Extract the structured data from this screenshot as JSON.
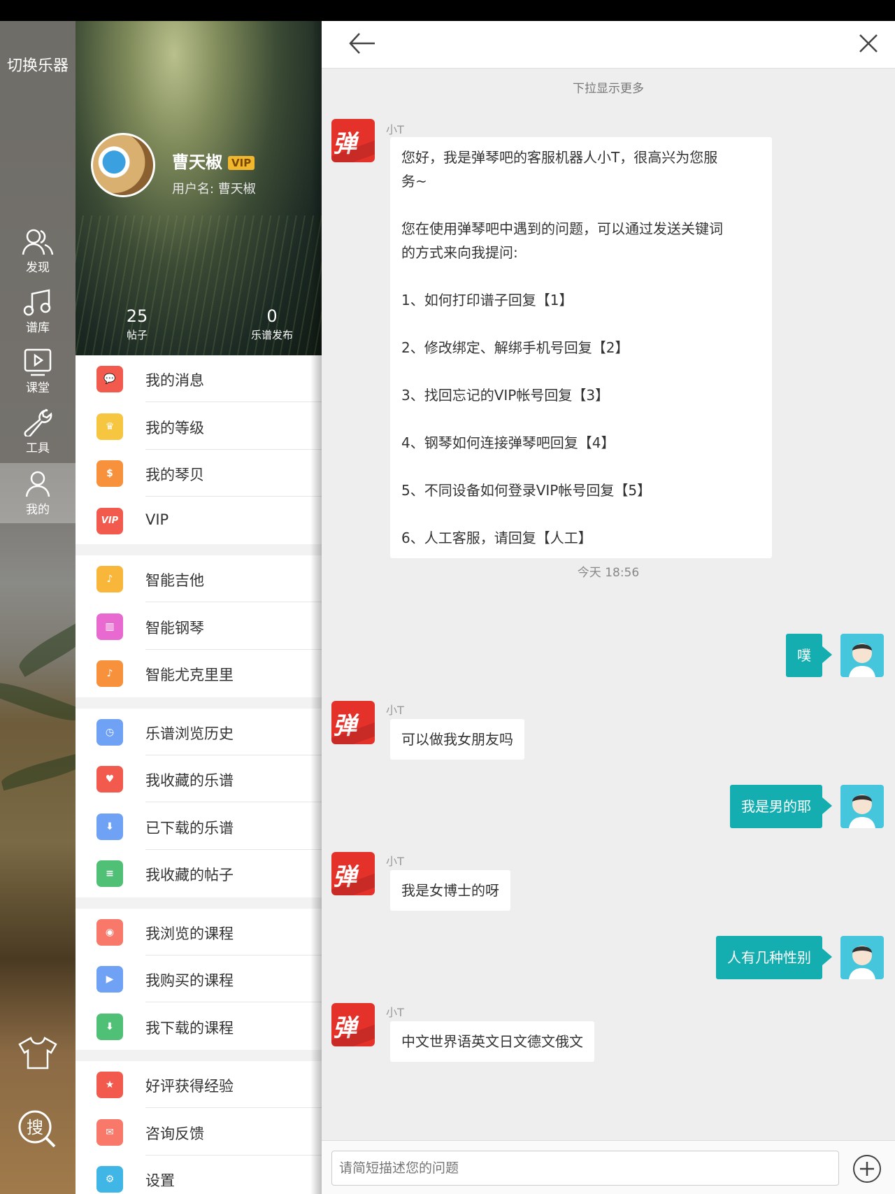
{
  "rail": {
    "switch_label": "切换乐器",
    "items": [
      {
        "label": "发现",
        "icon": "users-icon"
      },
      {
        "label": "谱库",
        "icon": "music-note-icon"
      },
      {
        "label": "课堂",
        "icon": "play-video-icon"
      },
      {
        "label": "工具",
        "icon": "wrench-icon"
      },
      {
        "label": "我的",
        "icon": "user-icon"
      }
    ],
    "active": "我的",
    "bottom": {
      "shirt_icon": "tshirt-icon",
      "search_label": "搜"
    }
  },
  "profile": {
    "name": "曹天椒",
    "vip": "VIP",
    "username": "用户名: 曹天椒",
    "stats": [
      {
        "value": "25",
        "label": "帖子"
      },
      {
        "value": "0",
        "label": "乐谱发布"
      }
    ],
    "menu": [
      {
        "label": "我的消息",
        "icon": "message-icon",
        "color": "#f25a4e",
        "glyph": "💬"
      },
      {
        "label": "我的等级",
        "icon": "crown-icon",
        "color": "#f6c640",
        "glyph": "♛"
      },
      {
        "label": "我的琴贝",
        "icon": "money-bag-icon",
        "color": "#f8913c",
        "glyph": "$"
      },
      {
        "label": "VIP",
        "icon": "vip-icon",
        "color": "#f25a4e",
        "glyph": "VIP"
      },
      {
        "label": "智能吉他",
        "icon": "guitar-icon",
        "color": "#f8b63a",
        "glyph": "♪"
      },
      {
        "label": "智能钢琴",
        "icon": "piano-icon",
        "color": "#e86ad0",
        "glyph": "▥"
      },
      {
        "label": "智能尤克里里",
        "icon": "ukulele-icon",
        "color": "#f8913c",
        "glyph": "♪"
      },
      {
        "label": "乐谱浏览历史",
        "icon": "clock-icon",
        "color": "#6fa2f5",
        "glyph": "◷"
      },
      {
        "label": "我收藏的乐谱",
        "icon": "heart-icon",
        "color": "#f25a4e",
        "glyph": "♥"
      },
      {
        "label": "已下载的乐谱",
        "icon": "download-icon",
        "color": "#6fa2f5",
        "glyph": "⬇"
      },
      {
        "label": "我收藏的帖子",
        "icon": "document-icon",
        "color": "#4fc076",
        "glyph": "≡"
      },
      {
        "label": "我浏览的课程",
        "icon": "eye-icon",
        "color": "#f8786a",
        "glyph": "◉"
      },
      {
        "label": "我购买的课程",
        "icon": "play-icon",
        "color": "#6fa2f5",
        "glyph": "▶"
      },
      {
        "label": "我下载的课程",
        "icon": "download-icon",
        "color": "#4fc076",
        "glyph": "⬇"
      },
      {
        "label": "好评获得经验",
        "icon": "star-icon",
        "color": "#f25a4e",
        "glyph": "★"
      },
      {
        "label": "咨询反馈",
        "icon": "mail-icon",
        "color": "#f8786a",
        "glyph": "✉"
      },
      {
        "label": "设置",
        "icon": "gear-icon",
        "color": "#3fb6e6",
        "glyph": "⚙"
      }
    ]
  },
  "chat": {
    "back_icon": "arrow-left-icon",
    "close_icon": "close-icon",
    "pull_hint": "下拉显示更多",
    "bot_name": "小T",
    "bot_logo": "弹琴吧",
    "bot_logo_big": "弹",
    "welcome_lines": [
      "您好，我是弹琴吧的客服机器人小T，很高兴为您服",
      "务~",
      "",
      "您在使用弹琴吧中遇到的问题，可以通过发送关键词",
      "的方式来向我提问:",
      "",
      "1、如何打印谱子回复【1】",
      "",
      "2、修改绑定、解绑手机号回复【2】",
      "",
      "3、找回忘记的VIP帐号回复【3】",
      "",
      "4、钢琴如何连接弹琴吧回复【4】",
      "",
      "5、不同设备如何登录VIP帐号回复【5】",
      "",
      "6、人工客服，请回复【人工】"
    ],
    "timestamp": "今天 18:56",
    "messages": [
      {
        "from": "me",
        "text": "噗"
      },
      {
        "from": "bot",
        "text": "可以做我女朋友吗"
      },
      {
        "from": "me",
        "text": "我是男的耶"
      },
      {
        "from": "bot",
        "text": "我是女博士的呀"
      },
      {
        "from": "me",
        "text": "人有几种性别"
      },
      {
        "from": "bot",
        "text": "中文世界语英文日文德文俄文"
      }
    ],
    "input_placeholder": "请简短描述您的问题",
    "plus_icon": "plus-circle-icon"
  }
}
